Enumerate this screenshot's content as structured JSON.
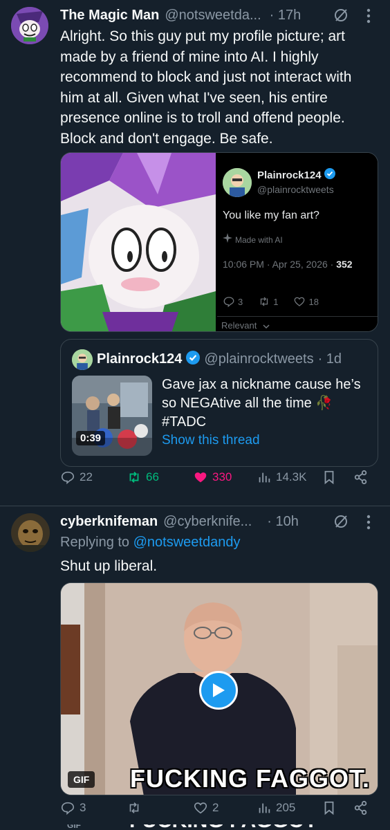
{
  "tweet1": {
    "name": "The Magic Man",
    "handle": "@notsweetda...",
    "time": "· 17h",
    "text": "Alright. So this guy put my profile picture; art made by a friend of mine into AI. I highly recommend to block and just not interact with him at all. Given what I've seen, his entire presence online is to troll and offend people. Block and don't engage. Be safe.",
    "embedded_post": {
      "name": "Plainrock124",
      "handle": "@plainrocktweets",
      "text": "You like my fan art?",
      "made_with": "Made with AI",
      "timestamp": "10:06 PM · Apr 25, 2026 ·",
      "views": "352",
      "replies": "3",
      "reposts": "1",
      "likes": "18",
      "sort": "Relevant"
    },
    "quote": {
      "name": "Plainrock124",
      "handle": "@plainrocktweets",
      "time": "· 1d",
      "text": "Gave jax a nickname cause he’s so NEGAtive all the time 🥀 #TADC",
      "show_thread": "Show this thread",
      "video_duration": "0:39"
    },
    "actions": {
      "replies": "22",
      "reposts": "66",
      "likes": "330",
      "views": "14.3K"
    }
  },
  "tweet2": {
    "name": "cyberknifeman",
    "handle": "@cyberknife...",
    "time": "· 10h",
    "replying_prefix": "Replying to",
    "replying_to": "@notsweetdandy",
    "text": "Shut up liberal.",
    "gif_badge": "GIF",
    "gif_caption": "FUCKING FAGGOT.",
    "actions": {
      "replies": "3",
      "reposts": "",
      "likes": "2",
      "views": "205"
    },
    "next_gif_badge": "GIF",
    "next_caption_partial": "FUCKING FAGGOT"
  },
  "colors": {
    "background": "#15202b",
    "accent": "#1d9bf0",
    "repost_active": "#00ba7c",
    "like_active": "#f91880",
    "muted": "#8b98a5",
    "border": "#38444d"
  }
}
